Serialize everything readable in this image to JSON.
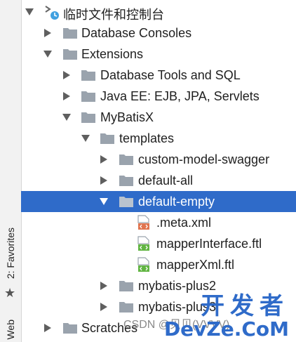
{
  "left_strip": {
    "favorites_tab": "2: Favorites",
    "web_tab": "Web",
    "star_icon": "star-icon"
  },
  "tree": {
    "rows": [
      {
        "label": "临时文件和控制台",
        "expanded": true,
        "icon": "scratches-console-icon"
      },
      {
        "label": "Database Consoles",
        "expanded": false,
        "icon": "folder-icon"
      },
      {
        "label": "Extensions",
        "expanded": true,
        "icon": "folder-icon"
      },
      {
        "label": "Database Tools and SQL",
        "expanded": false,
        "icon": "folder-icon"
      },
      {
        "label": "Java EE: EJB, JPA, Servlets",
        "expanded": false,
        "icon": "folder-icon"
      },
      {
        "label": "MyBatisX",
        "expanded": true,
        "icon": "folder-icon"
      },
      {
        "label": "templates",
        "expanded": true,
        "icon": "folder-icon"
      },
      {
        "label": "custom-model-swagger",
        "expanded": false,
        "icon": "folder-icon"
      },
      {
        "label": "default-all",
        "expanded": false,
        "icon": "folder-icon"
      },
      {
        "label": "default-empty",
        "expanded": true,
        "selected": true,
        "icon": "folder-icon"
      },
      {
        "label": ".meta.xml",
        "icon": "xml-file-icon"
      },
      {
        "label": "mapperInterface.ftl",
        "icon": "ftl-file-icon"
      },
      {
        "label": "mapperXml.ftl",
        "icon": "ftl-file-icon"
      },
      {
        "label": "mybatis-plus2",
        "expanded": false,
        "icon": "folder-icon"
      },
      {
        "label": "mybatis-plus3",
        "expanded": false,
        "icon": "folder-icon"
      },
      {
        "label": "Scratches",
        "expanded": false,
        "icon": "folder-icon"
      }
    ]
  },
  "watermark": {
    "text": "CSDN @贝贝(VVVV)",
    "logo_line1": "开发者",
    "logo_line2": "DevZe.CoM"
  },
  "colors": {
    "selection": "#2f6bc9",
    "folder": "#9aa3ad",
    "xml_badge": "#e0744f",
    "ftl_badge": "#62b543"
  }
}
